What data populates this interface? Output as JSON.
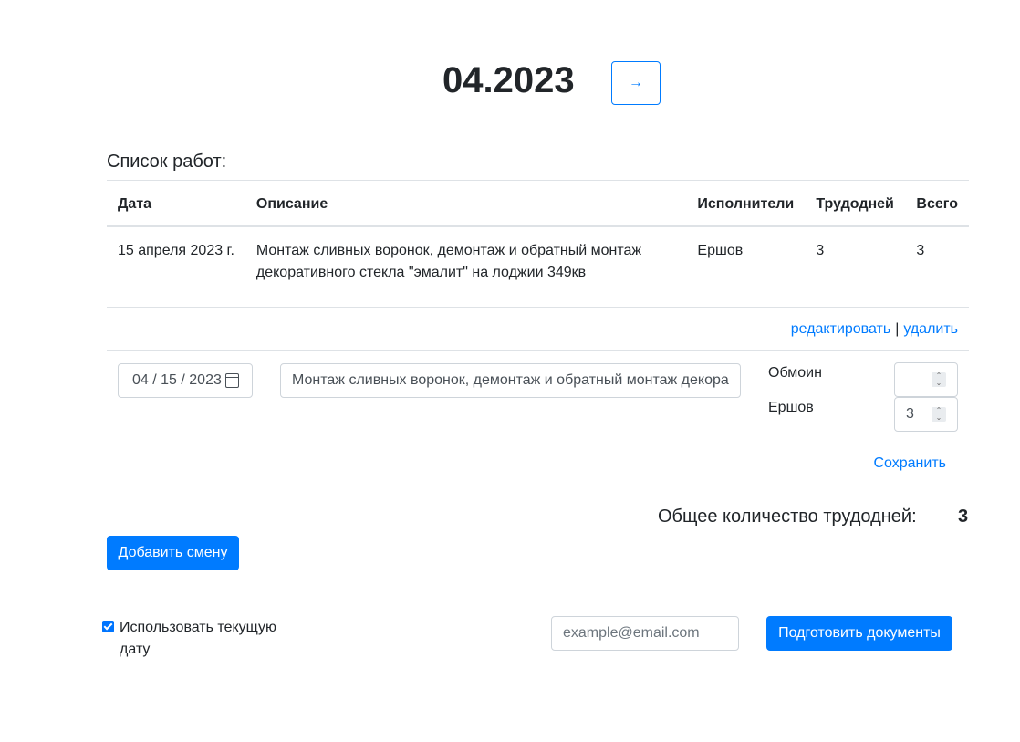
{
  "header": {
    "period": "04.2023",
    "next_label": "→"
  },
  "works": {
    "title": "Список работ:",
    "columns": [
      "Дата",
      "Описание",
      "Исполнители",
      "Трудодней",
      "Всего"
    ],
    "rows": [
      {
        "date": "15 апреля 2023 г.",
        "description": "Монтаж сливных воронок, демонтаж и обратный монтаж декоративного стекла \"эмалит\" на лоджии 349кв",
        "executors": "Ершов",
        "workdays": "3",
        "total": "3"
      }
    ],
    "edit_label": "редактировать",
    "separator": "|",
    "delete_label": "удалить"
  },
  "edit_form": {
    "date_value": "04 / 15 / 2023",
    "description_value": "Монтаж сливных воронок, демонтаж и обратный монтаж декора",
    "workers": [
      {
        "name": "Обмоин",
        "value": ""
      },
      {
        "name": "Ершов",
        "value": "3"
      }
    ],
    "save_label": "Сохранить"
  },
  "summary": {
    "total_label": "Общее количество трудодней:",
    "total_value": "3"
  },
  "actions": {
    "add_shift_label": "Добавить смену",
    "use_current_date_label": "Использовать текущую дату",
    "use_current_date_checked": true,
    "email_placeholder": "example@email.com",
    "prepare_docs_label": "Подготовить документы"
  },
  "colors": {
    "primary": "#007bff",
    "border": "#dee2e6",
    "text": "#212529"
  }
}
